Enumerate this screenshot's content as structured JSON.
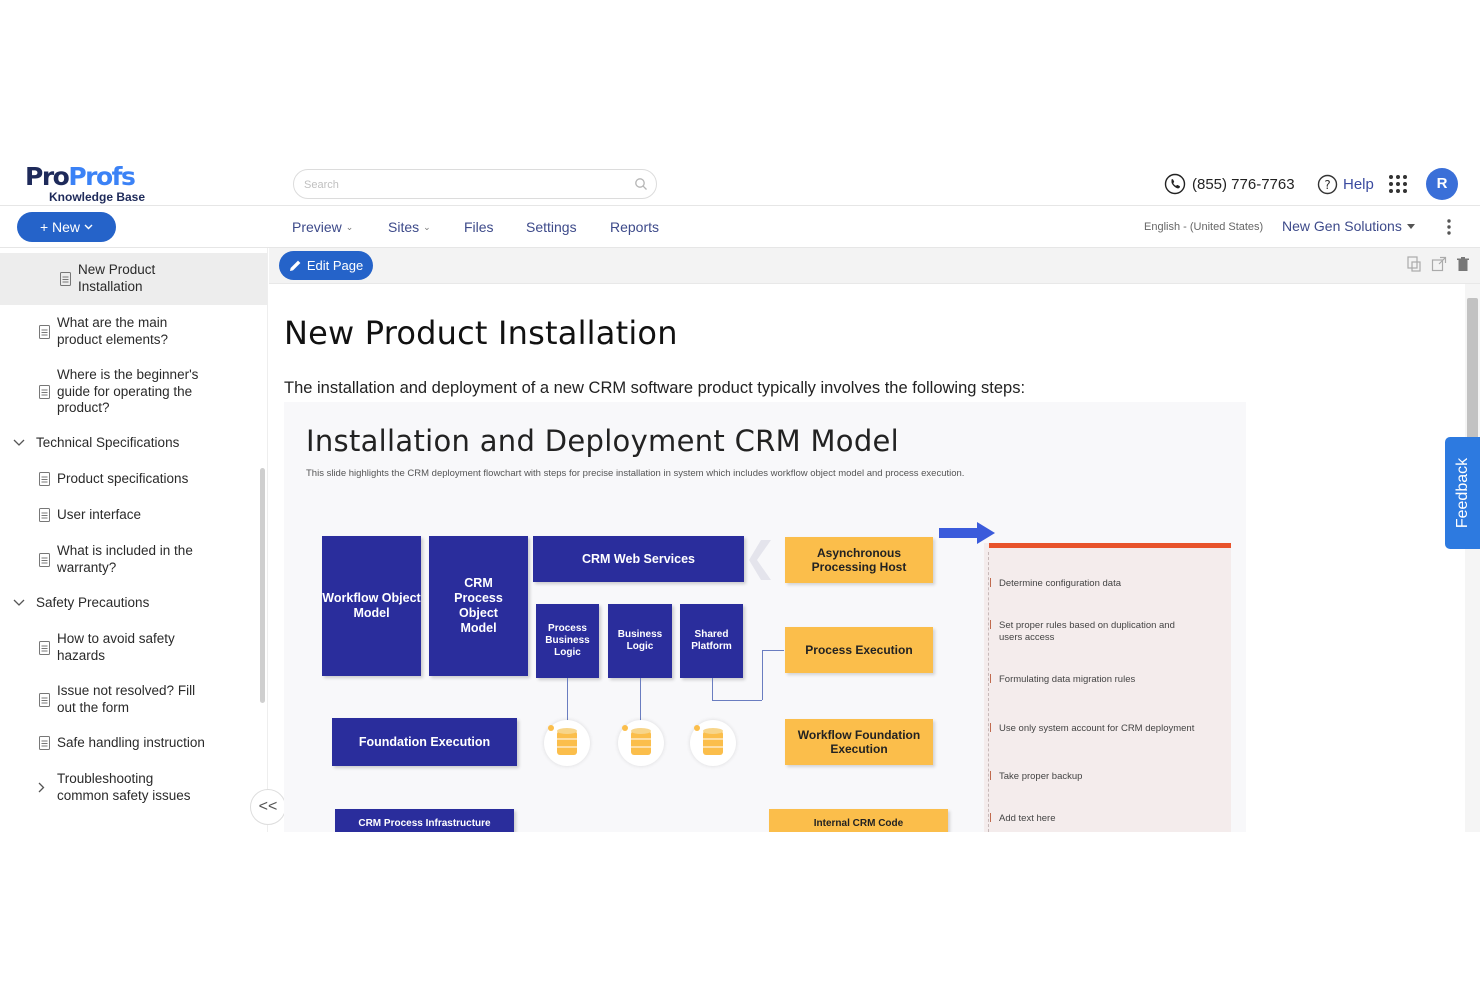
{
  "brand": {
    "logo_pro": "Pro",
    "logo_profs": "Profs",
    "logo_sub": "Knowledge Base"
  },
  "header": {
    "search_placeholder": "Search",
    "phone": "(855) 776-7763",
    "help": "Help",
    "avatar_initial": "R"
  },
  "nav": {
    "new_label": "+ New",
    "items": [
      "Preview",
      "Sites",
      "Files",
      "Settings",
      "Reports"
    ],
    "language": "English - (United States)",
    "company": "New Gen Solutions"
  },
  "sidebar": {
    "items": [
      {
        "label_1": "New Product",
        "label_2": "Installation"
      },
      {
        "label_1": "What are the main",
        "label_2": "product elements?"
      },
      {
        "label_1": "Where is the beginner's",
        "label_2": "guide for operating the",
        "label_3": "product?"
      },
      {
        "label_1": "Technical Specifications"
      },
      {
        "label_1": "Product specifications"
      },
      {
        "label_1": "User interface"
      },
      {
        "label_1": "What is included in the",
        "label_2": "warranty?"
      },
      {
        "label_1": "Safety Precautions"
      },
      {
        "label_1": "How to avoid safety",
        "label_2": "hazards"
      },
      {
        "label_1": "Issue not resolved? Fill",
        "label_2": "out the form"
      },
      {
        "label_1": "Safe handling instruction"
      },
      {
        "label_1": "Troubleshooting",
        "label_2": "common safety issues"
      }
    ],
    "collapse": "<<"
  },
  "toolbar": {
    "edit_label": "Edit Page"
  },
  "article": {
    "title": "New Product Installation",
    "intro": "The installation and deployment of a new CRM software product typically involves the following steps:"
  },
  "slide": {
    "title": "Installation and Deployment CRM Model",
    "subtitle": "This slide highlights the CRM deployment flowchart with steps for precise installation in system which includes workflow object model and process execution.",
    "workflow_object": "Workflow Object Model",
    "crm_process_object": "CRM Process Object Model",
    "crm_web_services": "CRM Web Services",
    "process_business_logic": "Process Business Logic",
    "business_logic": "Business Logic",
    "shared_platform": "Shared Platform",
    "foundation_execution": "Foundation Execution",
    "crm_process_infra": "CRM Process Infrastructure",
    "async_host": "Asynchronous Processing Host",
    "process_execution": "Process Execution",
    "workflow_foundation": "Workflow Foundation Execution",
    "internal_code": "Internal CRM Code",
    "steps": [
      "Determine configuration data",
      "Set proper rules based on duplication and users access",
      "Formulating data migration rules",
      "Use only system account for CRM deployment",
      "Take proper backup",
      "Add text here"
    ]
  },
  "feedback": "Feedback",
  "colors": {
    "primary": "#2563c9",
    "navy": "#2a2d9c",
    "gold": "#fbbe4b",
    "accent_red": "#e8532b"
  }
}
